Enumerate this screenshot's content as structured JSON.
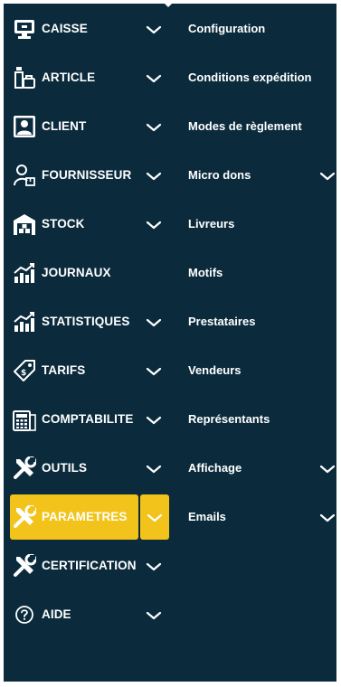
{
  "menu": {
    "items": [
      {
        "label": "CAISSE",
        "icon": "cash-register-icon",
        "chevron": true
      },
      {
        "label": "ARTICLE",
        "icon": "article-icon",
        "chevron": true
      },
      {
        "label": "CLIENT",
        "icon": "client-icon",
        "chevron": true
      },
      {
        "label": "FOURNISSEUR",
        "icon": "supplier-icon",
        "chevron": true
      },
      {
        "label": "STOCK",
        "icon": "warehouse-icon",
        "chevron": true
      },
      {
        "label": "JOURNAUX",
        "icon": "journal-chart-icon",
        "chevron": false
      },
      {
        "label": "STATISTIQUES",
        "icon": "statistics-chart-icon",
        "chevron": true
      },
      {
        "label": "TARIFS",
        "icon": "price-tag-icon",
        "chevron": true
      },
      {
        "label": "COMPTABILITE",
        "icon": "calculator-icon",
        "chevron": true
      },
      {
        "label": "OUTILS",
        "icon": "tools-icon",
        "chevron": true
      },
      {
        "label": "PARAMETRES",
        "icon": "tools-icon",
        "chevron": true,
        "active": true
      },
      {
        "label": "CERTIFICATION",
        "icon": "tools-icon",
        "chevron": true
      },
      {
        "label": "AIDE",
        "icon": "help-icon",
        "chevron": true
      }
    ]
  },
  "submenu": {
    "items": [
      {
        "label": "Configuration",
        "chevron": false
      },
      {
        "label": "Conditions expédition",
        "chevron": false
      },
      {
        "label": "Modes de règlement",
        "chevron": false
      },
      {
        "label": "Micro dons",
        "chevron": true
      },
      {
        "label": "Livreurs",
        "chevron": false
      },
      {
        "label": "Motifs",
        "chevron": false
      },
      {
        "label": "Prestataires",
        "chevron": false
      },
      {
        "label": "Vendeurs",
        "chevron": false
      },
      {
        "label": "Représentants",
        "chevron": false
      },
      {
        "label": "Affichage",
        "chevron": true
      },
      {
        "label": "Emails",
        "chevron": true
      }
    ]
  },
  "colors": {
    "background": "#0b2b3d",
    "highlight": "#f2c31a",
    "text": "#ffffff"
  }
}
